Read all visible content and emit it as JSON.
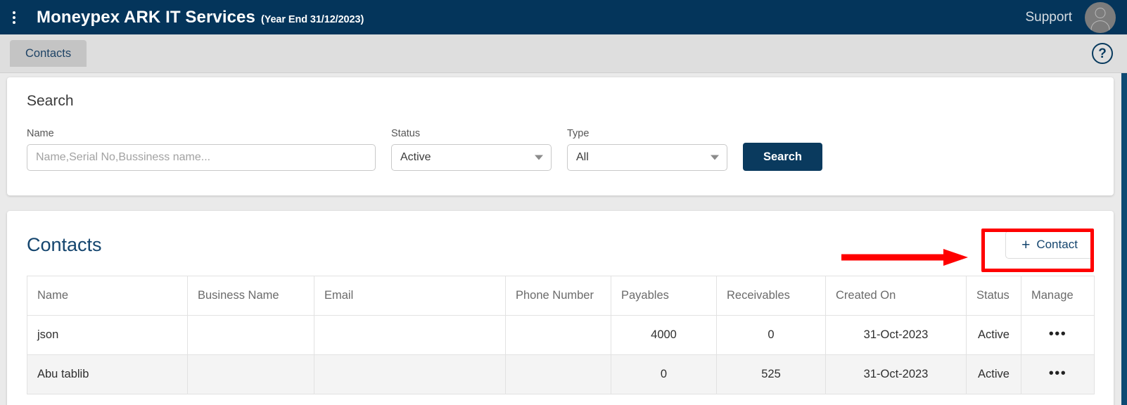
{
  "header": {
    "menu_icon": "kebab-menu-icon",
    "title": "Moneypex ARK IT Services",
    "year_end": "(Year End 31/12/2023)",
    "support_label": "Support",
    "avatar_icon": "user-avatar-icon",
    "background_color": "#04355b"
  },
  "tabbar": {
    "tabs": [
      {
        "label": "Contacts",
        "active": true
      }
    ],
    "help_icon": "help-question-icon"
  },
  "search_panel": {
    "title": "Search",
    "name_field": {
      "label": "Name",
      "value": "",
      "placeholder": "Name,Serial No,Bussiness name..."
    },
    "status_field": {
      "label": "Status",
      "selected": "Active",
      "caret_icon": "chevron-down-icon"
    },
    "type_field": {
      "label": "Type",
      "selected": "All",
      "caret_icon": "chevron-down-icon"
    },
    "search_button": {
      "label": "Search",
      "color": "#0a3a5e"
    }
  },
  "contacts_panel": {
    "title": "Contacts",
    "add_button": {
      "icon": "plus-icon",
      "plus": "+",
      "label": "Contact"
    },
    "table": {
      "columns": [
        "Name",
        "Business Name",
        "Email",
        "Phone Number",
        "Payables",
        "Receivables",
        "Created On",
        "Status",
        "Manage"
      ],
      "rows": [
        {
          "name": "json",
          "business_name": "",
          "email": "",
          "phone_number": "",
          "payables": "4000",
          "receivables": "0",
          "created_on": "31-Oct-2023",
          "status": "Active",
          "manage": "•••"
        },
        {
          "name": "Abu tablib",
          "business_name": "",
          "email": "",
          "phone_number": "",
          "payables": "0",
          "receivables": "525",
          "created_on": "31-Oct-2023",
          "status": "Active",
          "manage": "•••"
        }
      ]
    }
  },
  "annotation": {
    "color": "#ff0000",
    "highlight_target": "add-contact-button",
    "arrow_icon": "pointer-arrow-icon"
  }
}
